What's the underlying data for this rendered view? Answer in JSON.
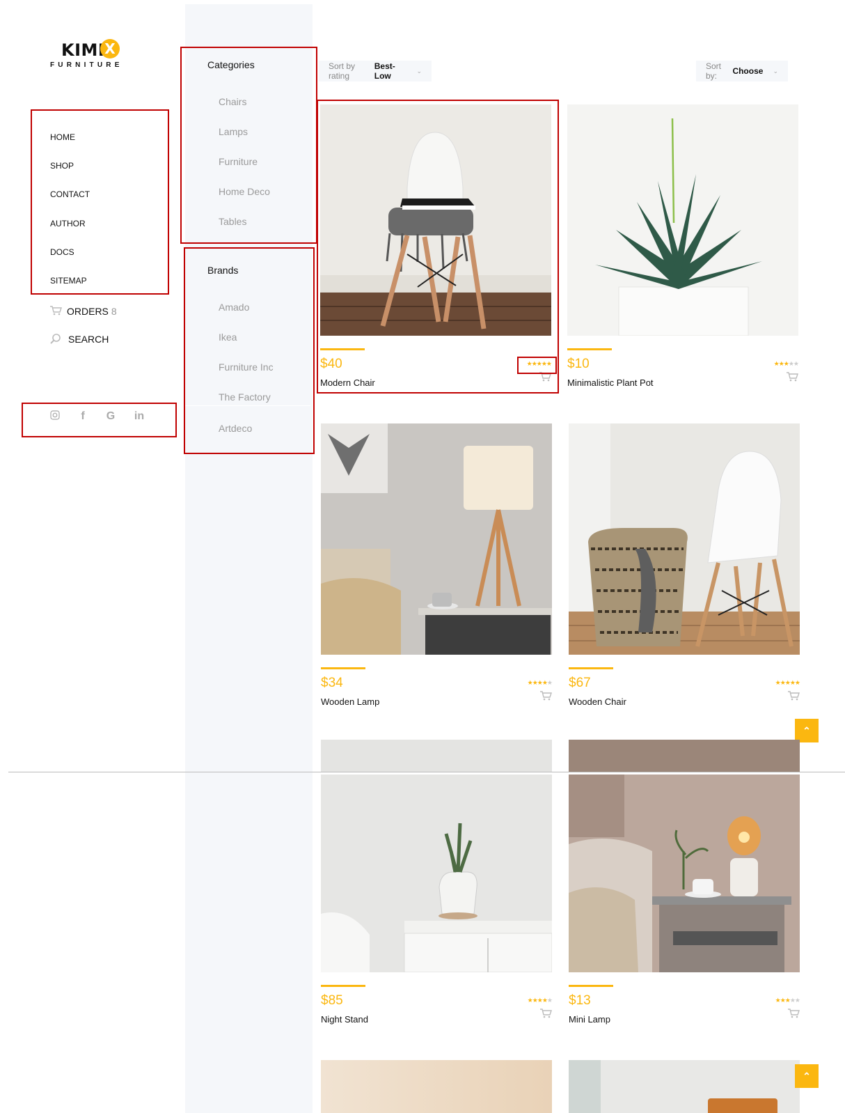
{
  "logo": {
    "name": "KIMI",
    "mark": "X",
    "sub": "FURNITURE"
  },
  "nav": [
    "HOME",
    "SHOP",
    "CONTACT",
    "AUTHOR",
    "DOCS",
    "SITEMAP"
  ],
  "orders": {
    "label": "ORDERS",
    "count": "8"
  },
  "search": {
    "label": "SEARCH"
  },
  "social_icons": [
    "instagram-icon",
    "facebook-icon",
    "google-icon",
    "linkedin-icon"
  ],
  "sidebar": {
    "categories_title": "Categories",
    "categories": [
      "Chairs",
      "Lamps",
      "Furniture",
      "Home Deco",
      "Tables"
    ],
    "brands_title": "Brands",
    "brands": [
      "Amado",
      "Ikea",
      "Furniture Inc",
      "The Factory",
      "Artdeco"
    ]
  },
  "sort_rating": {
    "label": "Sort by rating",
    "value": "Best-Low"
  },
  "sort_by": {
    "label": "Sort by:",
    "value": "Choose"
  },
  "colors": {
    "accent": "#fbb710",
    "highlight": "#c00000",
    "sidebar_bg": "#f5f7fa"
  },
  "products": [
    {
      "price": "$40",
      "name": "Modern Chair",
      "rating": 5
    },
    {
      "price": "$10",
      "name": "Minimalistic Plant Pot",
      "rating": 3
    },
    {
      "price": "$34",
      "name": "Wooden Lamp",
      "rating": 4
    },
    {
      "price": "$67",
      "name": "Wooden Chair",
      "rating": 5
    },
    {
      "price": "$85",
      "name": "Night Stand",
      "rating": 4
    },
    {
      "price": "$13",
      "name": "Mini Lamp",
      "rating": 3
    }
  ]
}
